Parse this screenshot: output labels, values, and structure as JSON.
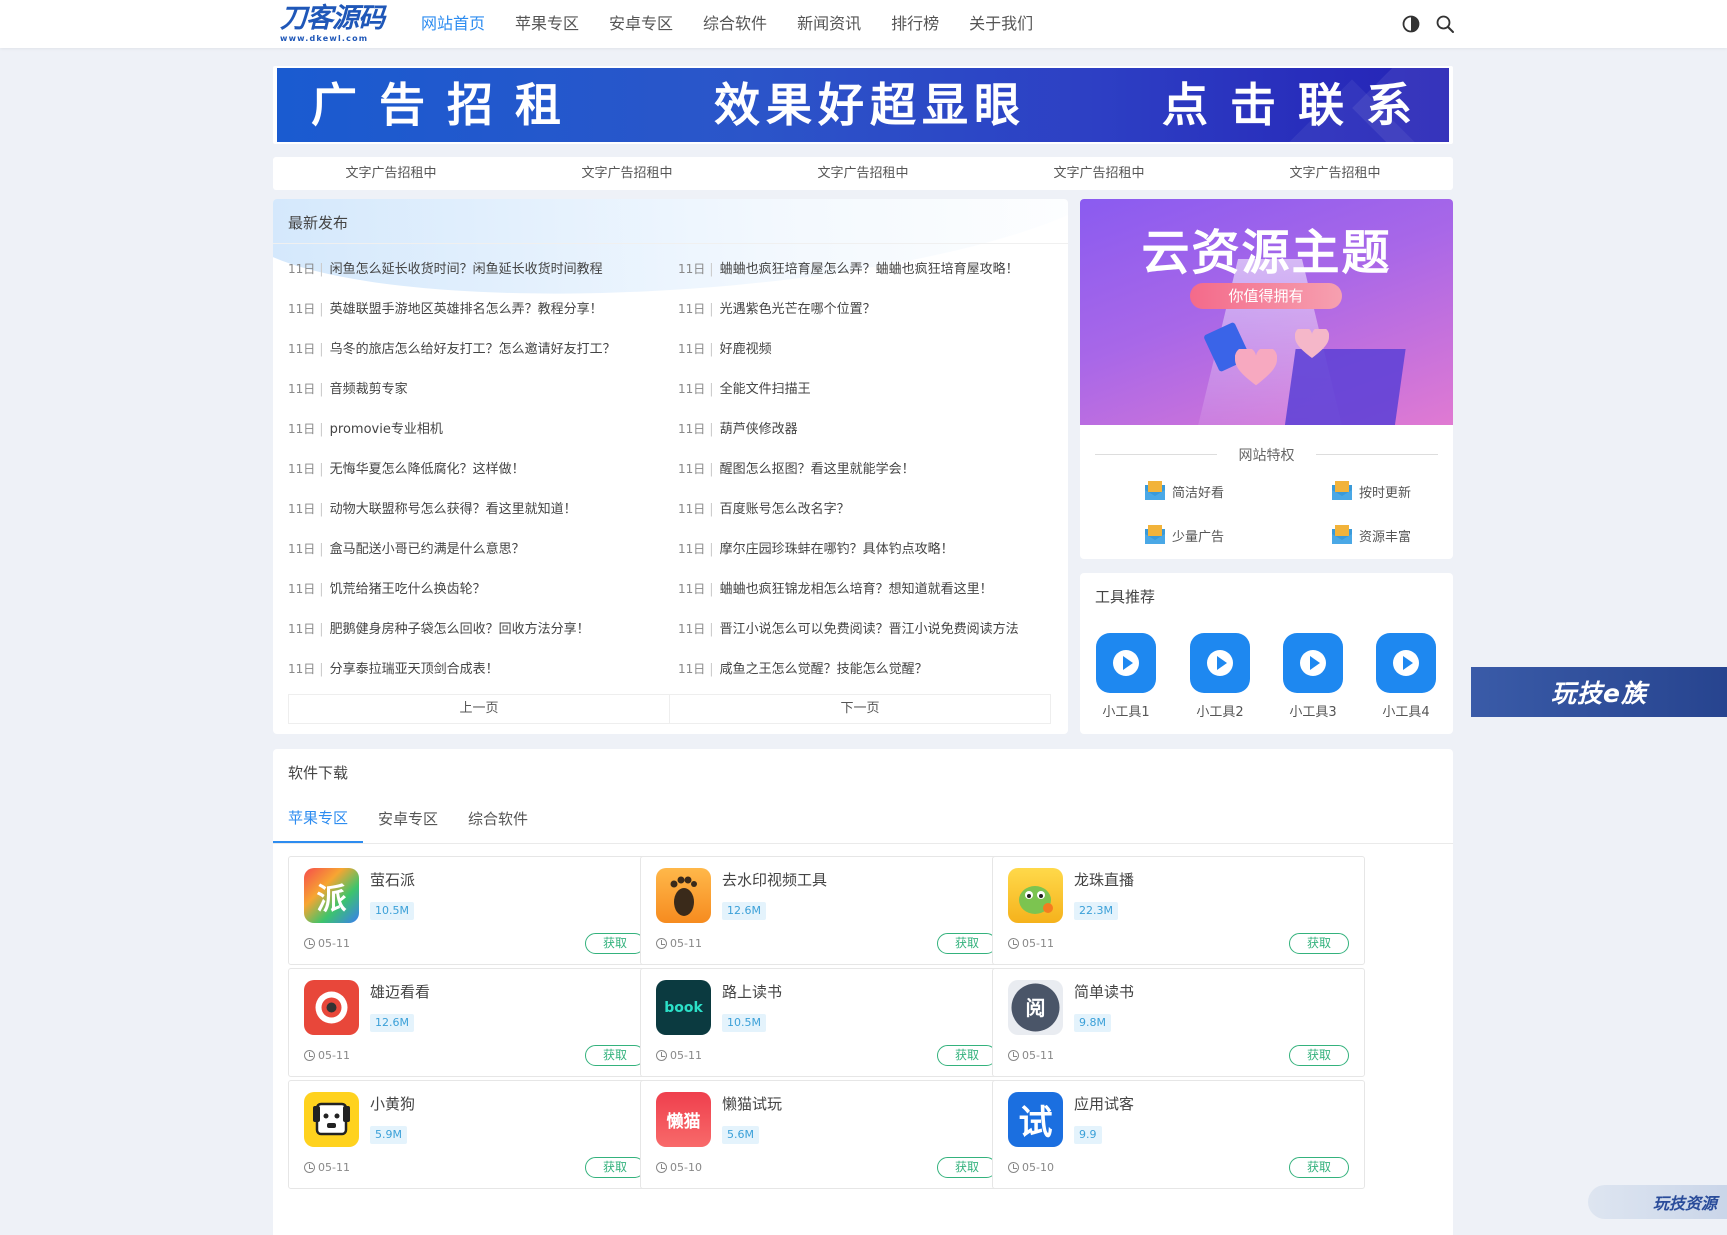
{
  "header": {
    "logo_text": "刀客源码",
    "logo_sub": "www.dkewl.com",
    "nav": [
      "网站首页",
      "苹果专区",
      "安卓专区",
      "综合软件",
      "新闻资讯",
      "排行榜",
      "关于我们"
    ],
    "active_nav": "网站首页",
    "icons": [
      "theme-toggle-icon",
      "search-icon"
    ]
  },
  "banner": {
    "part1": "广告招租",
    "part2": "效果好超显眼",
    "part3": "点击联系"
  },
  "text_ads": [
    "文字广告招租中",
    "文字广告招租中",
    "文字广告招租中",
    "文字广告招租中",
    "文字广告招租中"
  ],
  "latest": {
    "title": "最新发布",
    "left": [
      {
        "date": "11日",
        "title": "闲鱼怎么延长收货时间？闲鱼延长收货时间教程"
      },
      {
        "date": "11日",
        "title": "英雄联盟手游地区英雄排名怎么弄？教程分享！"
      },
      {
        "date": "11日",
        "title": "乌冬的旅店怎么给好友打工？怎么邀请好友打工？"
      },
      {
        "date": "11日",
        "title": "音频裁剪专家"
      },
      {
        "date": "11日",
        "title": "promovie专业相机"
      },
      {
        "date": "11日",
        "title": "无悔华夏怎么降低腐化？这样做！"
      },
      {
        "date": "11日",
        "title": "动物大联盟称号怎么获得？看这里就知道！"
      },
      {
        "date": "11日",
        "title": "盒马配送小哥已约满是什么意思？"
      },
      {
        "date": "11日",
        "title": "饥荒给猪王吃什么换齿轮？"
      },
      {
        "date": "11日",
        "title": "肥鹅健身房种子袋怎么回收？回收方法分享！"
      },
      {
        "date": "11日",
        "title": "分享泰拉瑞亚天顶剑合成表！"
      }
    ],
    "right": [
      {
        "date": "11日",
        "title": "蛐蛐也疯狂培育屋怎么弄？蛐蛐也疯狂培育屋攻略！"
      },
      {
        "date": "11日",
        "title": "光遇紫色光芒在哪个位置？"
      },
      {
        "date": "11日",
        "title": "好鹿视频"
      },
      {
        "date": "11日",
        "title": "全能文件扫描王"
      },
      {
        "date": "11日",
        "title": "葫芦侠修改器"
      },
      {
        "date": "11日",
        "title": "醒图怎么抠图？看这里就能学会！"
      },
      {
        "date": "11日",
        "title": "百度账号怎么改名字？"
      },
      {
        "date": "11日",
        "title": "摩尔庄园珍珠蚌在哪钓？具体钓点攻略！"
      },
      {
        "date": "11日",
        "title": "蛐蛐也疯狂锦龙相怎么培育？想知道就看这里！"
      },
      {
        "date": "11日",
        "title": "晋江小说怎么可以免费阅读？晋江小说免费阅读方法"
      },
      {
        "date": "11日",
        "title": "咸鱼之王怎么觉醒？技能怎么觉醒？"
      }
    ],
    "prev": "上一页",
    "next": "下一页"
  },
  "promo": {
    "title": "云资源主题",
    "pill": "你值得拥有",
    "privilege_title": "网站特权",
    "privileges": [
      "简洁好看",
      "按时更新",
      "少量广告",
      "资源丰富"
    ]
  },
  "tools": {
    "title": "工具推荐",
    "items": [
      "小工具1",
      "小工具2",
      "小工具3",
      "小工具4"
    ],
    "color": "#1e88f0"
  },
  "side_float": "玩技e族",
  "corner_logo": "玩技资源",
  "downloads": {
    "title": "软件下载",
    "tabs": [
      "苹果专区",
      "安卓专区",
      "综合软件"
    ],
    "active_tab": "苹果专区",
    "button_label": "获取",
    "apps": [
      {
        "name": "萤石派",
        "size": "10.5M",
        "date": "05-11",
        "icon": "pai-icon",
        "glyph": "派"
      },
      {
        "name": "去水印视频工具",
        "size": "12.6M",
        "date": "05-11",
        "icon": "footprint-icon",
        "glyph": ""
      },
      {
        "name": "龙珠直播",
        "size": "22.3M",
        "date": "05-11",
        "icon": "dragon-icon",
        "glyph": ""
      },
      {
        "name": "雄迈看看",
        "size": "12.6M",
        "date": "05-11",
        "icon": "camera-eye-icon",
        "glyph": ""
      },
      {
        "name": "路上读书",
        "size": "10.5M",
        "date": "05-11",
        "icon": "book-headphone-icon",
        "glyph": "book"
      },
      {
        "name": "简单读书",
        "size": "9.8M",
        "date": "05-11",
        "icon": "read-icon",
        "glyph": "阅"
      },
      {
        "name": "小黄狗",
        "size": "5.9M",
        "date": "05-11",
        "icon": "yellow-dog-icon",
        "glyph": ""
      },
      {
        "name": "懒猫试玩",
        "size": "5.6M",
        "date": "05-10",
        "icon": "lazy-cat-icon",
        "glyph": "懒猫"
      },
      {
        "name": "应用试客",
        "size": "9.9",
        "date": "05-10",
        "icon": "trial-icon",
        "glyph": "试"
      }
    ]
  }
}
